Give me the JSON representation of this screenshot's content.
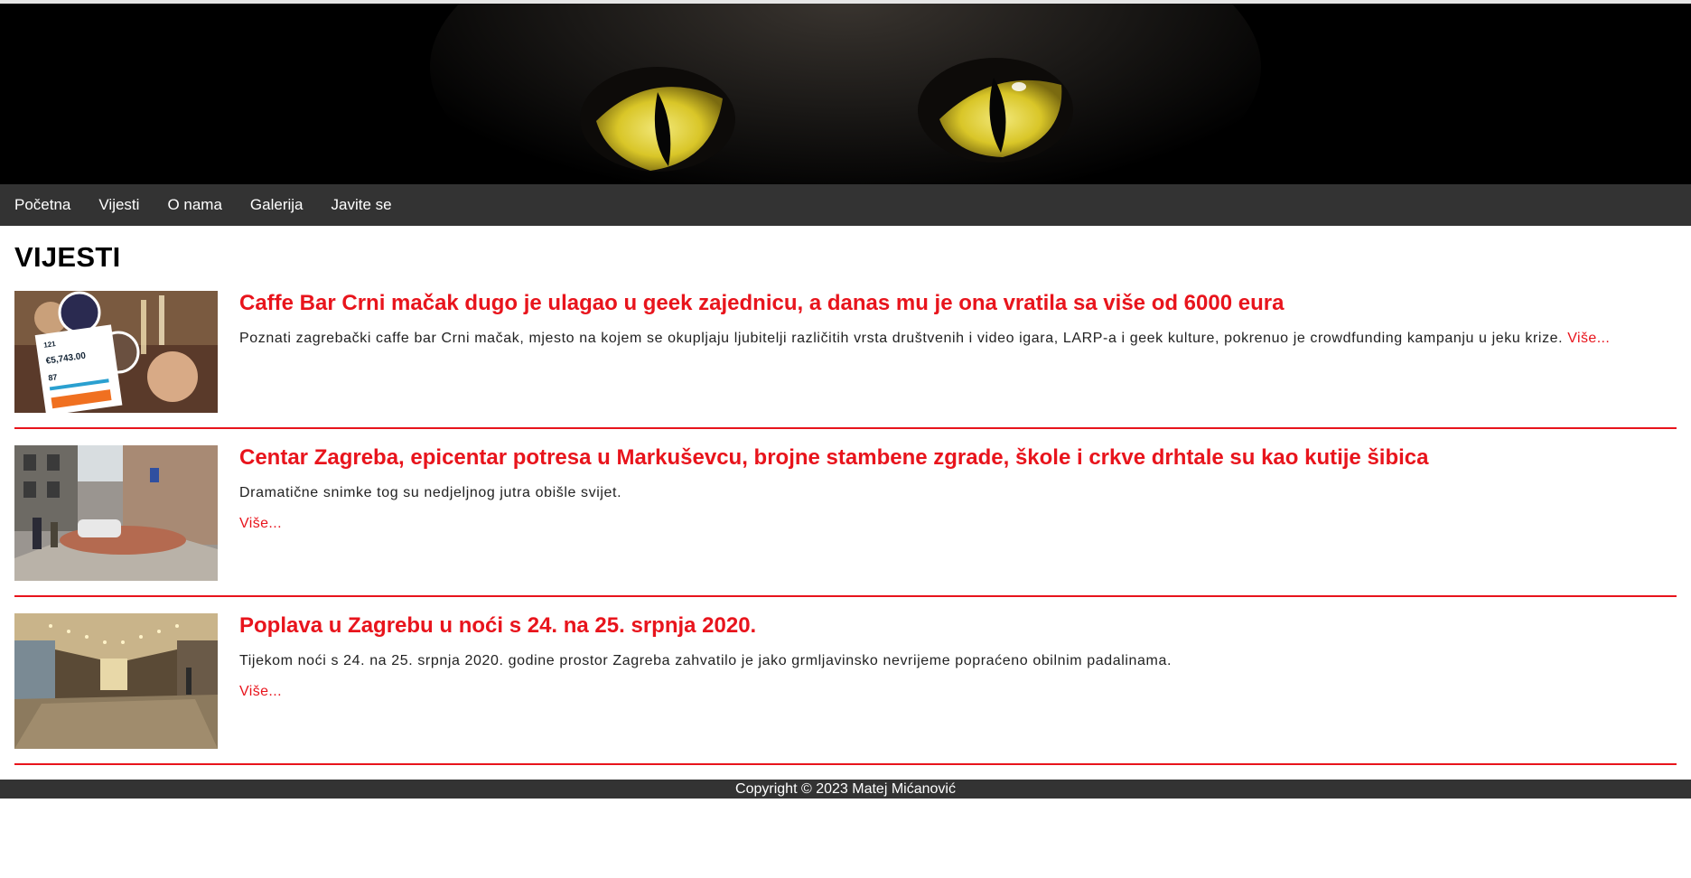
{
  "banner": {
    "image": "black-cat-yellow-eyes-banner"
  },
  "nav": {
    "items": [
      {
        "label": "Početna"
      },
      {
        "label": "Vijesti"
      },
      {
        "label": "O nama"
      },
      {
        "label": "Galerija"
      },
      {
        "label": "Javite se"
      }
    ]
  },
  "page": {
    "title": "VIJESTI"
  },
  "articles": [
    {
      "title": "Caffe Bar Crni mačak dugo je ulagao u geek zajednicu, a danas mu je ona vratila sa više od 6000 eura",
      "summary": "Poznati zagrebački caffe bar Crni mačak, mjesto na kojem se okupljaju ljubitelji različitih vrsta društvenih i video igara, LARP-a i geek kulture, pokrenuo je crowdfunding kampanju u jeku krize.",
      "more": "Više...",
      "thumb": "crowdfunding-party-photo",
      "thumb_text": {
        "backers": "121",
        "amount": "€5,743.00",
        "days": "87"
      }
    },
    {
      "title": "Centar Zagreba, epicentar potresa u Markuševcu, brojne stambene zgrade, škole i crkve drhtale su kao kutije šibica",
      "summary": "Dramatične snimke tog su nedjeljnog jutra obišle svijet.",
      "more": "Više...",
      "thumb": "earthquake-street-rubble-photo"
    },
    {
      "title": "Poplava u Zagrebu u noći s 24. na 25. srpnja 2020.",
      "summary": "Tijekom noći s 24. na 25. srpnja 2020. godine prostor Zagreba zahvatilo je jako grmljavinsko nevrijeme popraćeno obilnim padalinama.",
      "more": "Više...",
      "thumb": "flooded-underpass-photo"
    }
  ],
  "footer": {
    "text": "Copyright © 2023 Matej Mićanović"
  },
  "colors": {
    "accent": "#e8141c",
    "nav_bg": "#333333"
  }
}
